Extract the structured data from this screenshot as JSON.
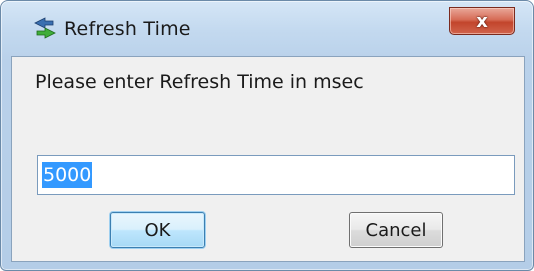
{
  "window": {
    "title": "Refresh Time",
    "icon": "refresh-arrows-icon",
    "close_label": "x"
  },
  "dialog": {
    "prompt": "Please enter Refresh Time in msec",
    "input_value": "5000",
    "ok_label": "OK",
    "cancel_label": "Cancel"
  },
  "colors": {
    "selection": "#3399ff",
    "close_button": "#c2452c",
    "default_button_border": "#3c7fb1"
  }
}
